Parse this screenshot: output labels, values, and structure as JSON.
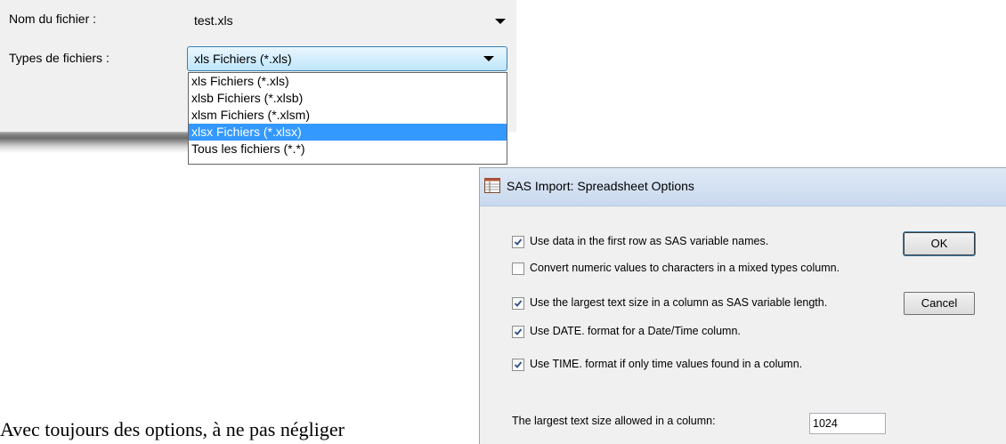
{
  "file_dialog": {
    "filename_label": "Nom du fichier :",
    "filename_value": "test.xls",
    "filetype_label": "Types de fichiers :",
    "filetype_selected": "xls Fichiers (*.xls)",
    "filetype_options": [
      "xls Fichiers (*.xls)",
      "xlsb Fichiers (*.xlsb)",
      "xlsm Fichiers (*.xlsm)",
      "xlsx Fichiers (*.xlsx)",
      "Tous les fichiers (*.*)"
    ],
    "highlighted_option": "xlsx Fichiers (*.xlsx)"
  },
  "sas_dialog": {
    "title": "SAS Import: Spreadsheet Options",
    "options": [
      {
        "label": "Use data in the first row as SAS variable names.",
        "checked": true
      },
      {
        "label": "Convert numeric values to characters in a mixed types column.",
        "checked": false
      },
      {
        "label": "Use the largest text size in a column as SAS variable length.",
        "checked": true
      },
      {
        "label": "Use DATE. format for a Date/Time column.",
        "checked": true
      },
      {
        "label": "Use TIME. format if only time values found in a column.",
        "checked": true
      }
    ],
    "ok_label": "OK",
    "cancel_label": "Cancel",
    "text_size_label": "The largest text size allowed in a column:",
    "text_size_value": "1024"
  },
  "caption": "Avec toujours des options, à ne pas négliger"
}
